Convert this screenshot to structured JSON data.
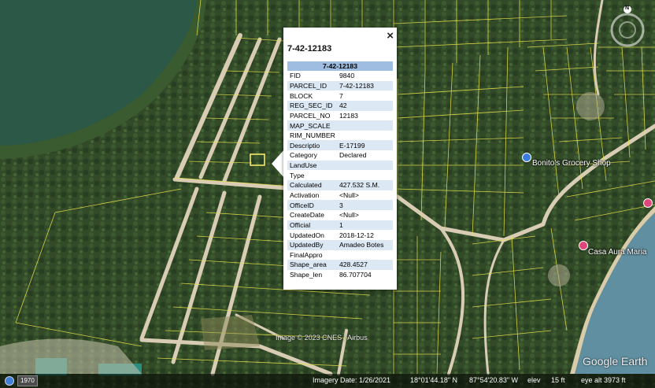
{
  "popup": {
    "title": "7-42-12183",
    "table_header": "7-42-12183",
    "close_label": "×",
    "rows": [
      {
        "key": "FID",
        "value": "9840"
      },
      {
        "key": "PARCEL_ID",
        "value": "7-42-12183"
      },
      {
        "key": "BLOCK",
        "value": "7"
      },
      {
        "key": "REG_SEC_ID",
        "value": "42"
      },
      {
        "key": "PARCEL_NO",
        "value": "12183"
      },
      {
        "key": "MAP_SCALE",
        "value": ""
      },
      {
        "key": "RIM_NUMBER",
        "value": ""
      },
      {
        "key": "Descriptio",
        "value": "E-17199"
      },
      {
        "key": "Category",
        "value": "Declared"
      },
      {
        "key": "LandUse",
        "value": ""
      },
      {
        "key": "Type",
        "value": ""
      },
      {
        "key": "Calculated",
        "value": "427.532 S.M."
      },
      {
        "key": "Activation",
        "value": "<Null>"
      },
      {
        "key": "OfficeID",
        "value": "3"
      },
      {
        "key": "CreateDate",
        "value": "<Null>"
      },
      {
        "key": "Official",
        "value": "1"
      },
      {
        "key": "UpdatedOn",
        "value": "2018-12-12"
      },
      {
        "key": "UpdatedBy",
        "value": "Amadeo Botes"
      },
      {
        "key": "FinalAppro",
        "value": ""
      },
      {
        "key": "Shape_area",
        "value": "428.4527"
      },
      {
        "key": "Shape_len",
        "value": "86.707704"
      }
    ]
  },
  "places": {
    "bonitos": "Bonito's Grocery Shop",
    "casa": "Casa Aura Maria",
    "bonitos_color": "#3b7ddd",
    "casa_color": "#e0457b"
  },
  "compass": {
    "north": "N"
  },
  "attribution": "Image © 2023 CNES / Airbus",
  "logo": "Google Earth",
  "status": {
    "year": "1970",
    "imagery_date": "Imagery Date: 1/26/2021",
    "lat": "18°01'44.18\" N",
    "lon": "87°54'20.83\" W",
    "elev_label": "elev",
    "elev_value": "15 ft",
    "eye_alt": "eye alt   3973 ft"
  },
  "colors": {
    "parcel_lines": "#e6e04a",
    "vegetation": "#2f4a26",
    "water": "#2a5a4e",
    "roads": "#d8cdb4"
  }
}
